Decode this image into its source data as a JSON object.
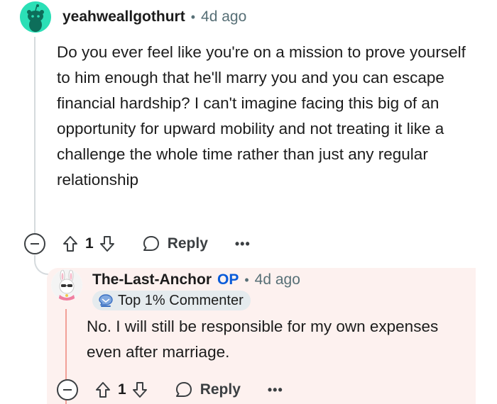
{
  "comment": {
    "username": "yeahweallgothurt",
    "separator": "•",
    "age": "4d ago",
    "body": "Do you ever feel like you're on a mission to prove yourself to him enough that he'll marry you and you can escape financial hardship? I can't imagine facing this big of an opportunity for upward mobility and not treating it like a challenge the whole time rather than just any regular relationship",
    "score": "1",
    "reply_label": "Reply",
    "more_label": "•••"
  },
  "reply": {
    "username": "The-Last-Anchor",
    "op_badge": "OP",
    "separator": "•",
    "age": "4d ago",
    "flair": "Top 1% Commenter",
    "body": "No. I will still be responsible for my own expenses even after marriage.",
    "score": "1",
    "reply_label": "Reply",
    "more_label": "•••"
  },
  "colors": {
    "avatar_main": "#2bdfb6",
    "op_badge": "#0a5bd9",
    "reply_bg": "#fdf1ef",
    "reply_line": "#f2a097"
  },
  "icons": [
    "snoo-avatar-icon",
    "collapse-icon",
    "upvote-icon",
    "downvote-icon",
    "chat-bubble-icon",
    "more-icon",
    "bunny-avatar-icon",
    "top-commenter-flair-icon"
  ]
}
